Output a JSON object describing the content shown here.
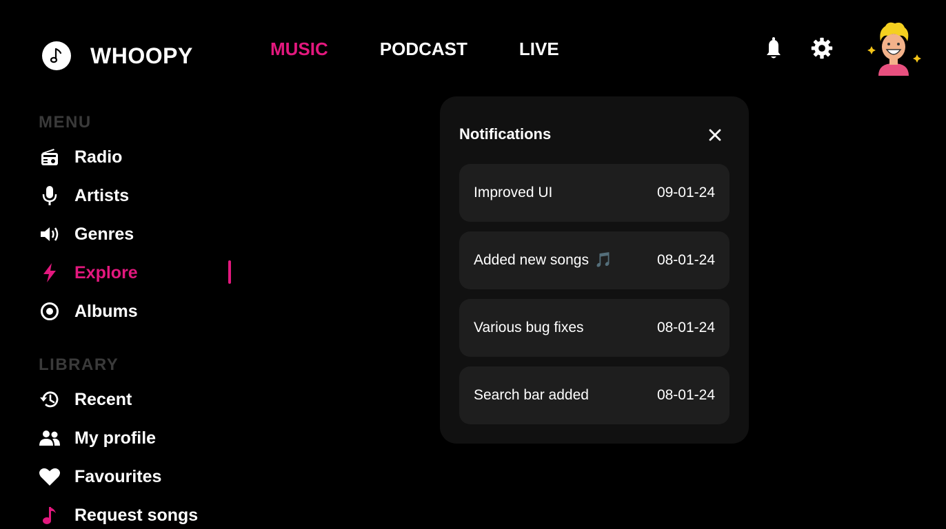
{
  "colors": {
    "accent": "#e3187e"
  },
  "brand": {
    "name": "WHOOPY",
    "icon": "music-note-icon"
  },
  "topnav": [
    {
      "label": "MUSIC",
      "active": true
    },
    {
      "label": "PODCAST",
      "active": false
    },
    {
      "label": "LIVE",
      "active": false
    }
  ],
  "header_icons": [
    "bell-icon",
    "gear-icon",
    "avatar"
  ],
  "sidebar": {
    "menu_title": "MENU",
    "menu_items": [
      {
        "label": "Radio",
        "icon": "radio-icon"
      },
      {
        "label": "Artists",
        "icon": "microphone-icon"
      },
      {
        "label": "Genres",
        "icon": "speaker-icon"
      },
      {
        "label": "Explore",
        "icon": "bolt-icon",
        "active": true
      },
      {
        "label": "Albums",
        "icon": "disc-icon"
      }
    ],
    "library_title": "LIBRARY",
    "library_items": [
      {
        "label": "Recent",
        "icon": "history-icon"
      },
      {
        "label": "My profile",
        "icon": "users-icon"
      },
      {
        "label": "Favourites",
        "icon": "heart-icon"
      },
      {
        "label": "Request songs",
        "icon": "music-note-icon"
      }
    ]
  },
  "notifications": {
    "title": "Notifications",
    "items": [
      {
        "text": "Improved UI",
        "date": "09-01-24"
      },
      {
        "text": "Added new songs",
        "emoji": "🎵",
        "date": "08-01-24"
      },
      {
        "text": "Various bug fixes",
        "date": "08-01-24"
      },
      {
        "text": "Search bar added",
        "date": "08-01-24"
      }
    ]
  }
}
